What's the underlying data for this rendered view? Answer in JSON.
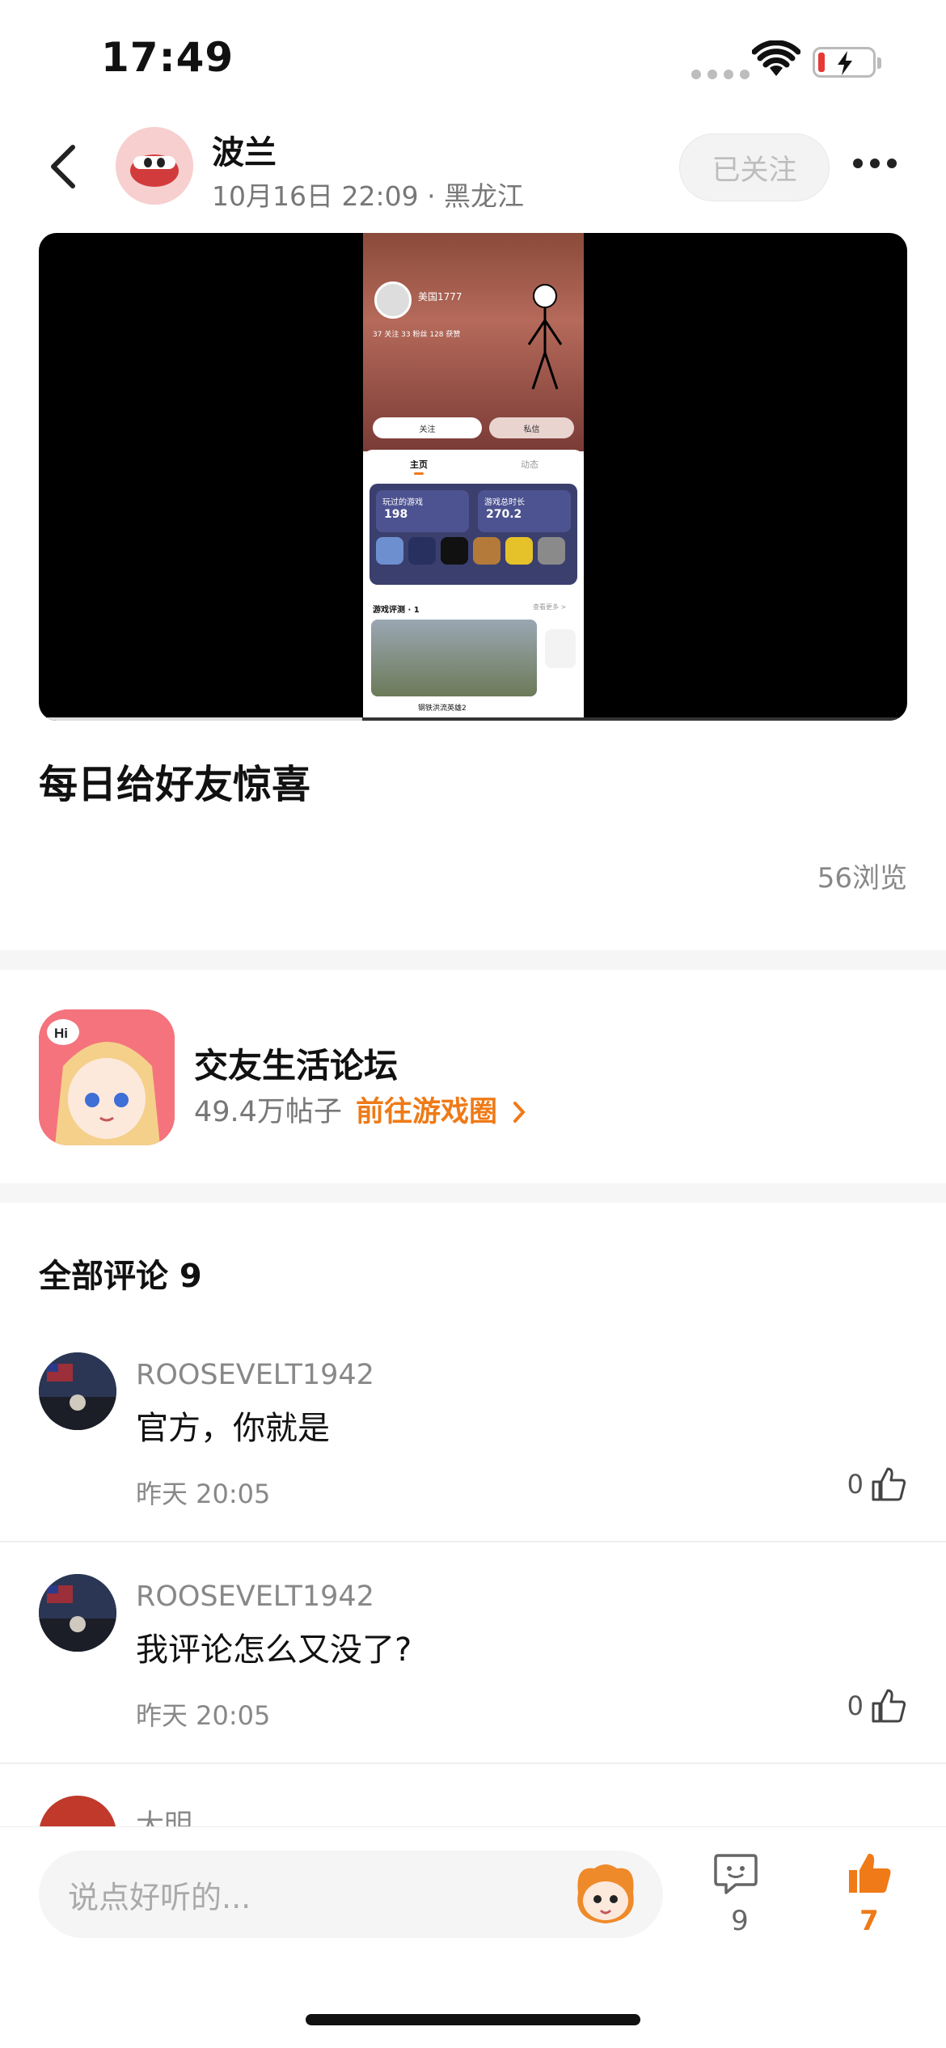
{
  "status_bar": {
    "time": "17:49"
  },
  "header": {
    "username": "波兰",
    "meta": "10月16日 22:09 · 黑龙江",
    "follow_label": "已关注"
  },
  "video": {
    "profile_name": "美国1777",
    "stats": "37 关注  33 粉丝  128 获赞",
    "follow_btn": "关注",
    "message_btn": "私信",
    "tab_home": "主页",
    "tab_activity": "动态",
    "games_played_label": "玩过的游戏",
    "games_played_value": "198",
    "playtime_label": "游戏总时长",
    "playtime_value": "270.2",
    "reviews_label": "游戏评测 · 1",
    "reviews_more": "查看更多 >",
    "game_name": "钢铁洪流英雄2"
  },
  "post": {
    "title": "每日给好友惊喜",
    "views": "56浏览"
  },
  "forum": {
    "name": "交友生活论坛",
    "posts": "49.4万帖子",
    "link": "前往游戏圈"
  },
  "comments": {
    "title": "全部评论 9",
    "items": [
      {
        "name": "ROOSEVELT1942",
        "text": "官方，你就是",
        "time": "昨天 20:05",
        "likes": "0"
      },
      {
        "name": "ROOSEVELT1942",
        "text": "我评论怎么又没了?",
        "time": "昨天 20:05",
        "likes": "0"
      },
      {
        "name": "大明"
      }
    ]
  },
  "bottom": {
    "placeholder": "说点好听的...",
    "comment_count": "9",
    "like_count": "7"
  },
  "colors": {
    "accent": "#ef7a17",
    "muted": "#888888"
  }
}
